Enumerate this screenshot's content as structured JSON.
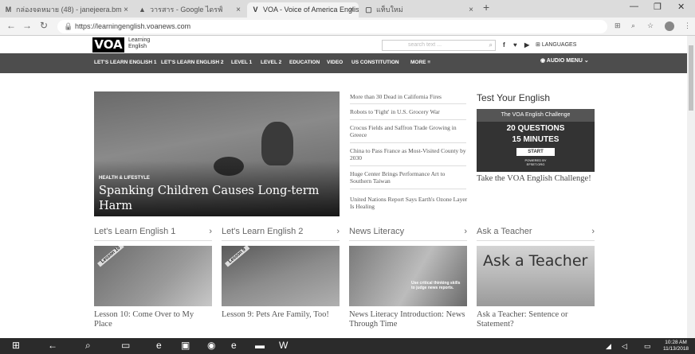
{
  "browser": {
    "tabs": [
      {
        "title": "กล่องจดหมาย (48) - janejeera.bm",
        "icon": "gmail-icon"
      },
      {
        "title": "วารสาร - Google ไดรฟ์",
        "icon": "drive-icon"
      },
      {
        "title": "VOA - Voice of America English",
        "icon": "voa-icon"
      },
      {
        "title": "แท็บใหม่",
        "icon": "page-icon"
      }
    ],
    "url": "https://learningenglish.voanews.com"
  },
  "site": {
    "logo": "VOA",
    "logo_sub_1": "Learning",
    "logo_sub_2": "English",
    "search_placeholder": "search text ...",
    "languages_label": "LANGUAGES",
    "nav": [
      "LET'S LEARN ENGLISH 1",
      "LET'S LEARN ENGLISH 2",
      "LEVEL 1",
      "LEVEL 2",
      "EDUCATION",
      "VIDEO",
      "US CONSTITUTION",
      "MORE ≡"
    ],
    "audio_menu": "AUDIO MENU"
  },
  "hero": {
    "tag": "HEALTH & LIFESTYLE",
    "title": "Spanking Children Causes Long-term Harm"
  },
  "headlines": [
    "More than 30 Dead in California Fires",
    "Robots to 'Fight' in U.S. Grocery War",
    "Crocus Fields and Saffron Trade Growing in Greece",
    "China to Pass France as Most-Visited County by 2030",
    "Huge Center Brings Performance Art to Southern Taiwan",
    "United Nations Report Says Earth's Ozone Layer Is Healing"
  ],
  "test_english": {
    "title": "Test Your English",
    "box_top": "The VOA English Challenge",
    "line1": "20 QUESTIONS",
    "line2": "15 MINUTES",
    "start": "START",
    "powered": "POWERED BY",
    "powered_org": "EFSET.ORG",
    "desc": "Take the VOA English Challenge!"
  },
  "sections": [
    {
      "title": "Let's Learn English 1",
      "badge": "Lesson 10",
      "caption": "Lesson 10: Come Over to My Place"
    },
    {
      "title": "Let's Learn English 2",
      "badge": "Lesson 9",
      "caption": "Lesson 9: Pets Are Family, Too!"
    },
    {
      "title": "News Literacy",
      "badge": "Use critical thinking skills to judge news reports.",
      "caption": "News Literacy Introduction: News Through Time"
    },
    {
      "title": "Ask a Teacher",
      "badge": "Ask a Teacher",
      "caption": "Ask a Teacher: Sentence or Statement?"
    }
  ],
  "taskbar": {
    "time": "10:28 AM",
    "date": "11/13/2018"
  }
}
